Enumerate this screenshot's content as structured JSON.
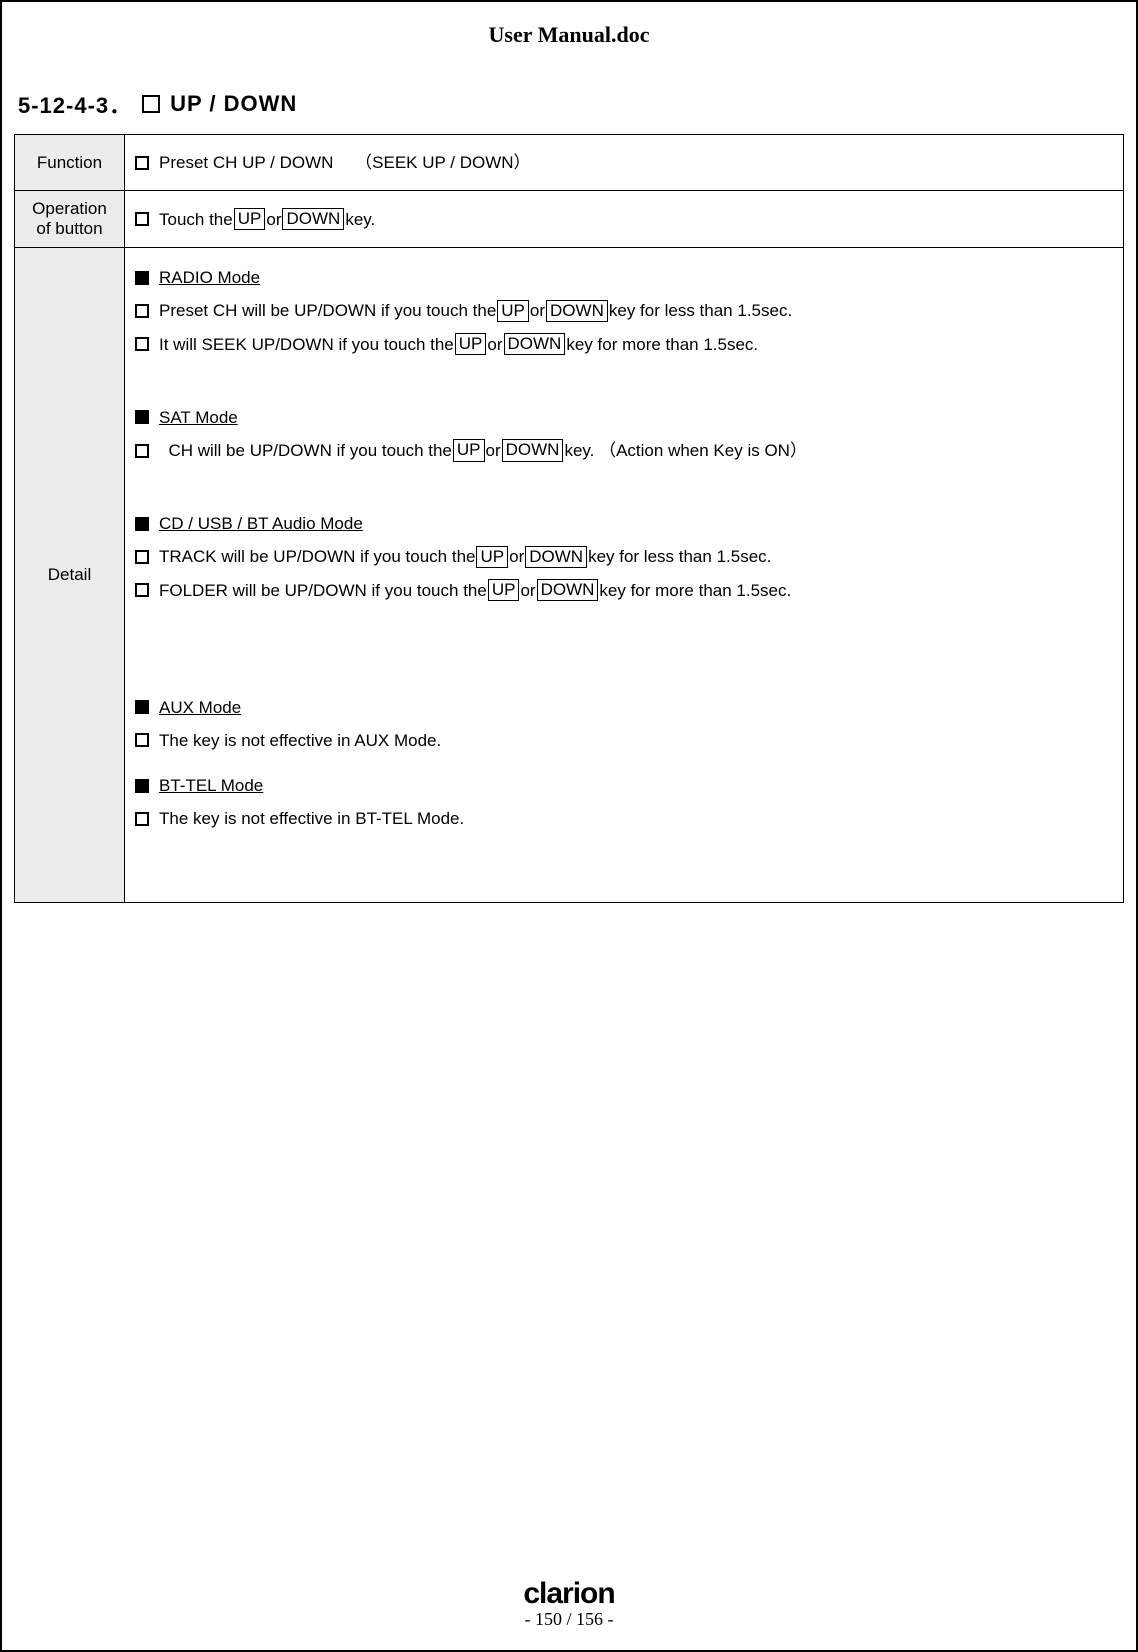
{
  "doc_title": "User Manual.doc",
  "section": {
    "number": "5-12-4-3．",
    "title": "UP / DOWN"
  },
  "rows": {
    "function": {
      "label": "Function",
      "text": "Preset CH UP / DOWN　 （SEEK UP / DOWN）"
    },
    "operation": {
      "label_line1": "Operation",
      "label_line2": "of button",
      "prefix": "Touch the ",
      "key1": "UP",
      "mid": " or ",
      "key2": "DOWN",
      "suffix": " key."
    },
    "detail": {
      "label": "Detail",
      "radio": {
        "heading": "RADIO Mode",
        "line1_pre": "Preset CH will be UP/DOWN if you touch the ",
        "line1_k1": "UP",
        "line1_mid": " or ",
        "line1_k2": "DOWN",
        "line1_post": " key for less than 1.5sec.",
        "line2_pre": "It will SEEK UP/DOWN if you touch the ",
        "line2_k1": "UP",
        "line2_mid": " or ",
        "line2_k2": "DOWN",
        "line2_post": " key for more than 1.5sec."
      },
      "sat": {
        "heading": "SAT Mode",
        "line1_pre": "CH will be UP/DOWN if you touch the ",
        "line1_k1": "UP",
        "line1_mid": " or ",
        "line1_k2": "DOWN",
        "line1_post": " key. （Action when Key is ON）"
      },
      "cd": {
        "heading": "CD / USB / BT Audio Mode",
        "line1_pre": "TRACK will be UP/DOWN if you touch the ",
        "line1_k1": "UP",
        "line1_mid": " or ",
        "line1_k2": "DOWN",
        "line1_post": " key for less than 1.5sec.",
        "line2_pre": "FOLDER will be UP/DOWN if you touch the ",
        "line2_k1": "UP",
        "line2_mid": " or ",
        "line2_k2": "DOWN",
        "line2_post": " key for more than 1.5sec."
      },
      "aux": {
        "heading": "AUX Mode",
        "line1": "The key is not effective in AUX Mode."
      },
      "bttel": {
        "heading": "BT-TEL Mode",
        "line1": "The key is not effective in BT-TEL Mode."
      }
    }
  },
  "footer": {
    "brand": "clarion",
    "page": "- 150 / 156 -"
  }
}
